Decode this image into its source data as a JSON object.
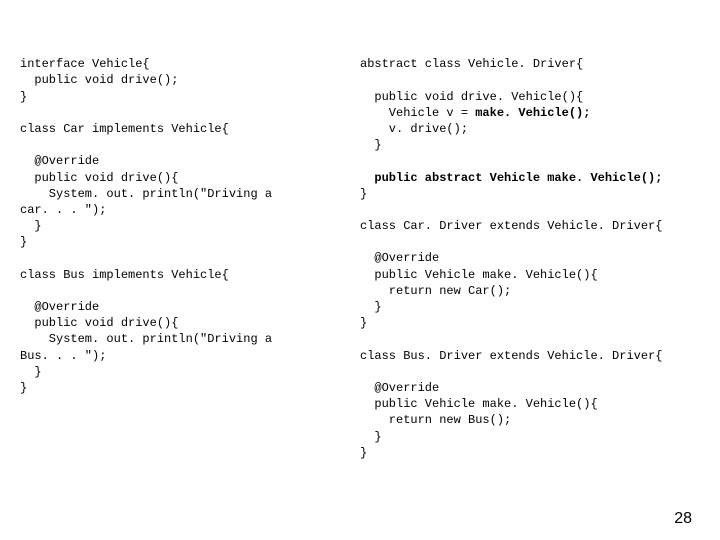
{
  "left": {
    "l1": "interface Vehicle{",
    "l2": "  public void drive();",
    "l3": "}",
    "l4": "",
    "l5": "class Car implements Vehicle{",
    "l6": "",
    "l7": "  @Override",
    "l8": "  public void drive(){",
    "l9": "    System. out. println(\"Driving a",
    "l10": "car. . . \");",
    "l11": "  }",
    "l12": "}",
    "l13": "",
    "l14": "class Bus implements Vehicle{",
    "l15": "",
    "l16": "  @Override",
    "l17": "  public void drive(){",
    "l18": "    System. out. println(\"Driving a",
    "l19": "Bus. . . \");",
    "l20": "  }",
    "l21": "}"
  },
  "right": {
    "l1": "abstract class Vehicle. Driver{",
    "l2": "",
    "l3": "  public void drive. Vehicle(){",
    "l4a": "    Vehicle v = ",
    "l4b": "make. Vehicle();",
    "l5": "    v. drive();",
    "l6": "  }",
    "l7": "",
    "l8": "  public abstract Vehicle make. Vehicle();",
    "l9": "}",
    "l10": "",
    "l11": "class Car. Driver extends Vehicle. Driver{",
    "l12": "",
    "l13": "  @Override",
    "l14": "  public Vehicle make. Vehicle(){",
    "l15": "    return new Car();",
    "l16": "  }",
    "l17": "}",
    "l18": "",
    "l19": "class Bus. Driver extends Vehicle. Driver{",
    "l20": "",
    "l21": "  @Override",
    "l22": "  public Vehicle make. Vehicle(){",
    "l23": "    return new Bus();",
    "l24": "  }",
    "l25": "}"
  },
  "page_number": "28"
}
